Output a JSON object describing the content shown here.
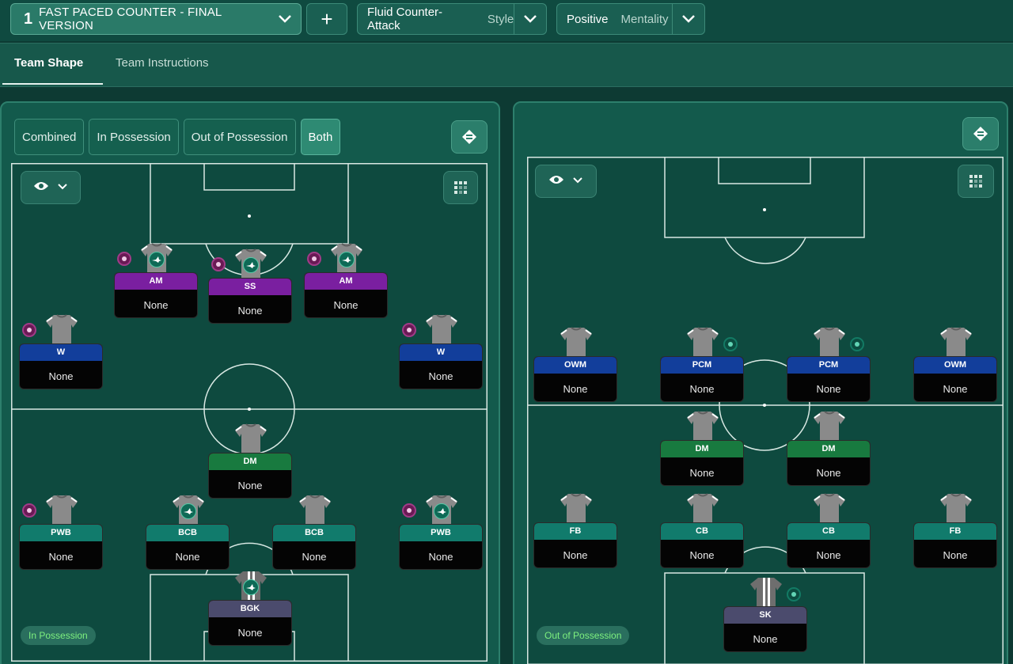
{
  "header": {
    "tactic_number": "1",
    "tactic_name": "FAST PACED COUNTER - FINAL VERSION",
    "add_label": "+",
    "style_value": "Fluid Counter-Attack",
    "style_label": "Style",
    "mentality_value": "Positive",
    "mentality_label": "Mentality"
  },
  "tabs": [
    {
      "label": "Team Shape",
      "active": true
    },
    {
      "label": "Team Instructions",
      "active": false
    }
  ],
  "left_panel": {
    "view_modes": [
      {
        "label": "Combined",
        "active": false
      },
      {
        "label": "In Possession",
        "active": false
      },
      {
        "label": "Out of Possession",
        "active": false
      },
      {
        "label": "Both",
        "active": true
      }
    ],
    "pitch_badge": "In Possession",
    "players": [
      {
        "role": "AM",
        "name": "None",
        "color": "purple"
      },
      {
        "role": "SS",
        "name": "None",
        "color": "purple"
      },
      {
        "role": "AM",
        "name": "None",
        "color": "purple"
      },
      {
        "role": "W",
        "name": "None",
        "color": "blue"
      },
      {
        "role": "W",
        "name": "None",
        "color": "blue"
      },
      {
        "role": "DM",
        "name": "None",
        "color": "green"
      },
      {
        "role": "PWB",
        "name": "None",
        "color": "teal"
      },
      {
        "role": "BCB",
        "name": "None",
        "color": "teal"
      },
      {
        "role": "BCB",
        "name": "None",
        "color": "teal"
      },
      {
        "role": "PWB",
        "name": "None",
        "color": "teal"
      },
      {
        "role": "BGK",
        "name": "None",
        "color": "slate"
      }
    ]
  },
  "right_panel": {
    "pitch_badge": "Out of Possession",
    "players": [
      {
        "role": "OWM",
        "name": "None",
        "color": "blue"
      },
      {
        "role": "PCM",
        "name": "None",
        "color": "blue"
      },
      {
        "role": "PCM",
        "name": "None",
        "color": "blue"
      },
      {
        "role": "OWM",
        "name": "None",
        "color": "blue"
      },
      {
        "role": "DM",
        "name": "None",
        "color": "green"
      },
      {
        "role": "DM",
        "name": "None",
        "color": "green"
      },
      {
        "role": "FB",
        "name": "None",
        "color": "teal"
      },
      {
        "role": "CB",
        "name": "None",
        "color": "teal"
      },
      {
        "role": "CB",
        "name": "None",
        "color": "teal"
      },
      {
        "role": "FB",
        "name": "None",
        "color": "teal"
      },
      {
        "role": "SK",
        "name": "None",
        "color": "slate"
      }
    ]
  },
  "icons": {
    "chevron": "chevron-down-icon",
    "eye": "eye-icon",
    "grid": "grid-icon",
    "tilt": "pitch-rotate-icon",
    "role_badge": "plane-role-icon"
  },
  "colors": {
    "purple": "#7a1fa0",
    "blue": "#123e9b",
    "green": "#187a3f",
    "teal": "#117b6c",
    "slate": "#4b4b6d",
    "badge_text": "#7df07f"
  }
}
